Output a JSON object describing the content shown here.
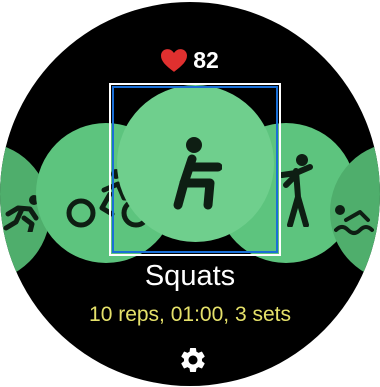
{
  "status": {
    "heart_rate": "82",
    "heart_icon": "heart-icon",
    "heart_color": "#e0302f"
  },
  "carousel": {
    "items": [
      {
        "icon": "running-icon"
      },
      {
        "icon": "cycling-icon"
      },
      {
        "icon": "squats-icon",
        "selected": true
      },
      {
        "icon": "kickboxing-icon"
      },
      {
        "icon": "swimming-icon"
      }
    ]
  },
  "workout": {
    "name": "Squats",
    "details": "10 reps, 01:00, 3 sets"
  },
  "settings_icon": "gear-icon",
  "colors": {
    "background": "#000000",
    "bubble": "#5dc47e",
    "details_text": "#e5e16a",
    "focus_outline": "#1a6fd6"
  }
}
